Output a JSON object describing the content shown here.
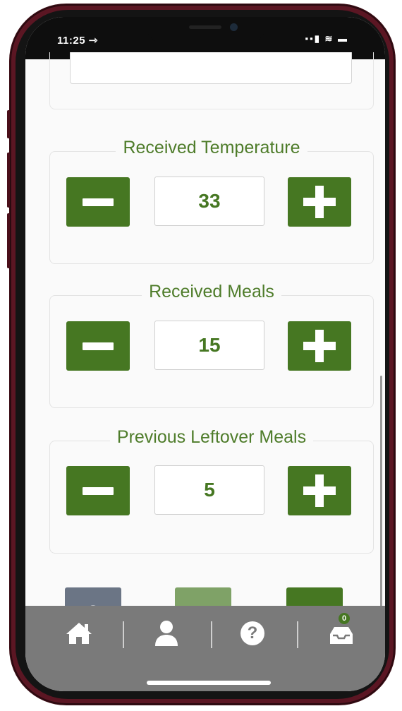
{
  "status_bar": {
    "time": "11:25 ⇾",
    "signal_wifi_battery": "▪▪▮ ≋ ▬"
  },
  "received_temperature": {
    "label": "Received Temperature",
    "value": "33"
  },
  "received_meals": {
    "label": "Received Meals",
    "value": "15"
  },
  "previous_leftover_meals": {
    "label": "Previous Leftover Meals",
    "value": "5"
  },
  "actions": {
    "cancel_icon": "cancel-icon",
    "save_icon": "save-icon",
    "next_icon": "double-chevron-right-icon",
    "next_glyph": "»"
  },
  "bottom_nav": {
    "items": [
      "home-icon",
      "user-icon",
      "help-icon",
      "inbox-icon"
    ],
    "help_glyph": "?",
    "inbox_badge": "0"
  },
  "colors": {
    "accent_green": "#467722",
    "save_green_disabled": "#7fa267",
    "cancel_gray": "#6b7585",
    "nav_gray": "#7a7a7a",
    "frame": "#5b1623"
  }
}
